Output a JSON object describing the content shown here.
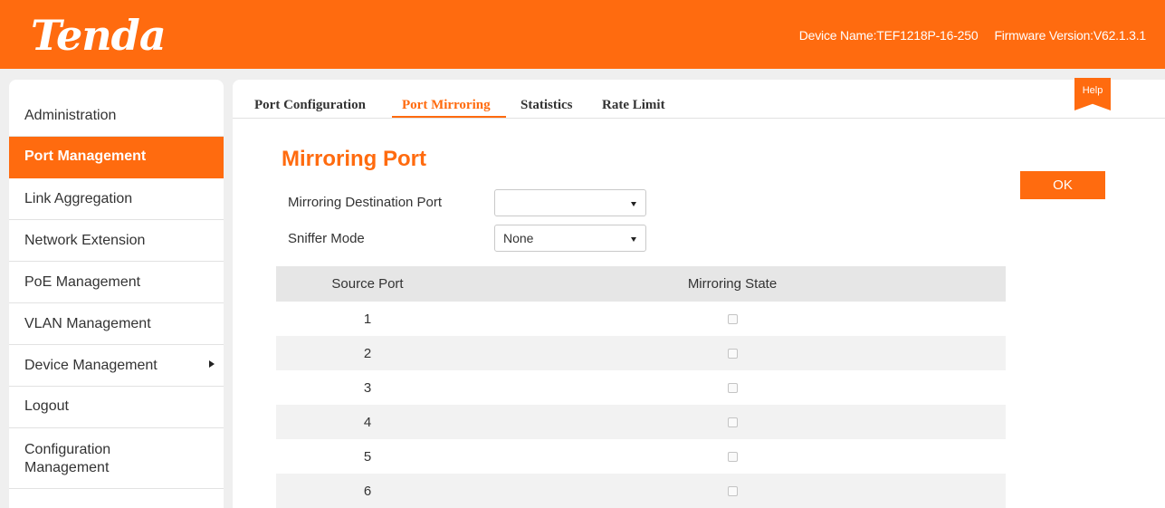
{
  "header": {
    "logo": "Tenda",
    "device_name": "Device Name:TEF1218P-16-250",
    "firmware_version": "Firmware Version:V62.1.3.1"
  },
  "sidebar": {
    "items": [
      {
        "label": "Administration"
      },
      {
        "label": "Port Management",
        "active": true
      },
      {
        "label": "Link Aggregation"
      },
      {
        "label": "Network Extension"
      },
      {
        "label": "PoE Management"
      },
      {
        "label": "VLAN Management"
      },
      {
        "label": "Device Management",
        "has_submenu": true
      },
      {
        "label": "Logout"
      },
      {
        "label": "Configuration Management"
      }
    ]
  },
  "tabs": [
    {
      "label": "Port Configuration"
    },
    {
      "label": "Port Mirroring",
      "active": true
    },
    {
      "label": "Statistics"
    },
    {
      "label": "Rate Limit"
    }
  ],
  "help_label": "Help",
  "section_title": "Mirroring Port",
  "ok_label": "OK",
  "form": {
    "destination_label": "Mirroring Destination Port",
    "destination_value": "",
    "sniffer_label": "Sniffer Mode",
    "sniffer_value": "None"
  },
  "table": {
    "headers": [
      "Source Port",
      "Mirroring State"
    ],
    "rows": [
      {
        "port": "1",
        "checked": false
      },
      {
        "port": "2",
        "checked": false
      },
      {
        "port": "3",
        "checked": false
      },
      {
        "port": "4",
        "checked": false
      },
      {
        "port": "5",
        "checked": false
      },
      {
        "port": "6",
        "checked": false
      }
    ]
  },
  "colors": {
    "accent": "#ff6b0f"
  }
}
